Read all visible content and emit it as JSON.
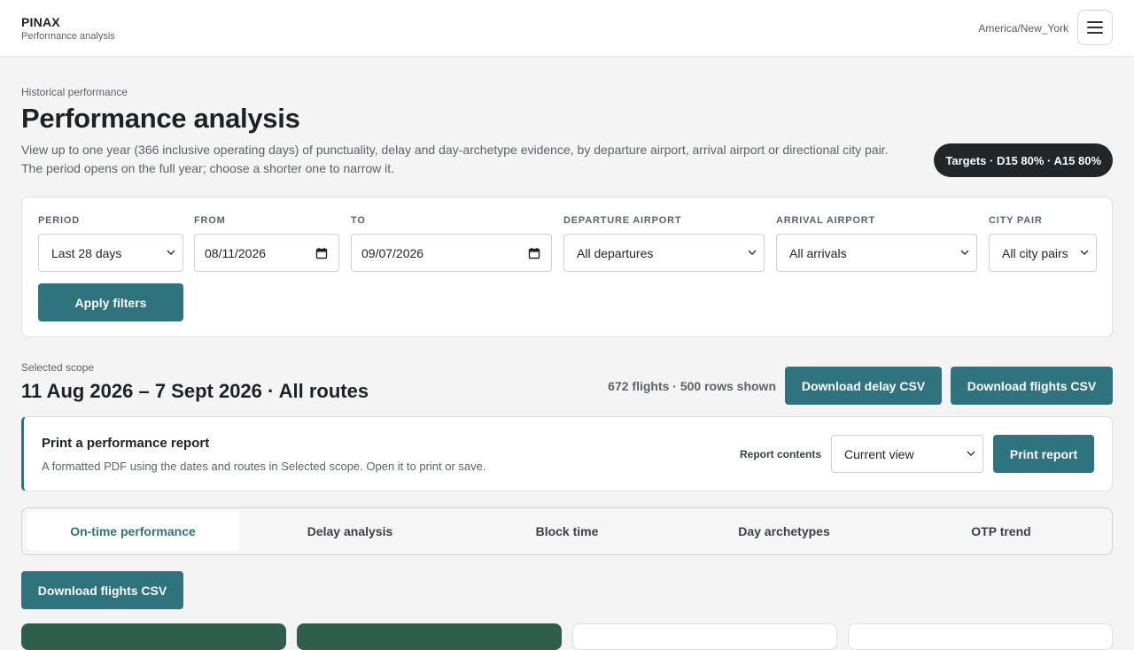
{
  "header": {
    "brand": "PINAX",
    "subtitle": "Performance analysis",
    "timezone": "America/New_York",
    "menu_icon": "hamburger-icon"
  },
  "intro": {
    "eyebrow": "Historical performance",
    "title": "Performance analysis",
    "description": "View up to one year (366 inclusive operating days) of punctuality, delay and day-archetype evidence, by departure airport, arrival airport or directional city pair. The period opens on the full year; choose a shorter one to narrow it.",
    "targets": "Targets · D15 80% · A15 80%"
  },
  "filters": {
    "period": {
      "label": "PERIOD",
      "value": "Last 28 days"
    },
    "from": {
      "label": "FROM",
      "value": "08/11/2026"
    },
    "to": {
      "label": "TO",
      "value": "09/07/2026"
    },
    "departure": {
      "label": "DEPARTURE AIRPORT",
      "value": "All departures"
    },
    "arrival": {
      "label": "ARRIVAL AIRPORT",
      "value": "All arrivals"
    },
    "city_pair": {
      "label": "CITY PAIR",
      "value": "All city pairs"
    },
    "apply_label": "Apply filters"
  },
  "scope": {
    "label": "Selected scope",
    "title": "11 Aug 2026 – 7 Sept 2026 · All routes",
    "count": "672 flights · 500 rows shown",
    "download_delay": "Download delay CSV",
    "download_flights": "Download flights CSV"
  },
  "report": {
    "title": "Print a performance report",
    "description": "A formatted PDF using the dates and routes in Selected scope. Open it to print or save.",
    "contents_label": "Report contents",
    "contents_value": "Current view",
    "print_label": "Print report"
  },
  "tabs": [
    {
      "label": "On-time performance",
      "active": true
    },
    {
      "label": "Delay analysis",
      "active": false
    },
    {
      "label": "Block time",
      "active": false
    },
    {
      "label": "Day archetypes",
      "active": false
    },
    {
      "label": "OTP trend",
      "active": false
    }
  ],
  "tab_actions": {
    "download_flights": "Download flights CSV"
  },
  "colors": {
    "accent": "#2e737e",
    "dark_green": "#2f5f4a",
    "badge_bg": "#222629"
  }
}
